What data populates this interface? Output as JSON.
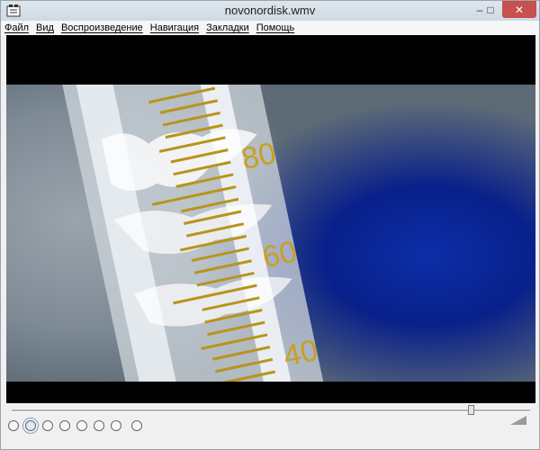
{
  "window": {
    "title": "novonordisk.wmv",
    "close_glyph": "✕",
    "min_glyph": "–",
    "max_glyph": "□"
  },
  "menu": {
    "items": [
      {
        "label": "Файл"
      },
      {
        "label": "Вид"
      },
      {
        "label": "Воспроизведение"
      },
      {
        "label": "Навигация"
      },
      {
        "label": "Закладки"
      },
      {
        "label": "Помощь"
      }
    ]
  },
  "video_frame": {
    "cylinder_labels": [
      "80",
      "60",
      "40"
    ],
    "label_color": "#c9a020"
  },
  "player": {
    "seek_position": 0.885,
    "icons": [
      "play-icon",
      "pause-icon",
      "stop-icon",
      "prev-icon",
      "next-icon",
      "step-back-icon",
      "step-forward-icon",
      "open-icon",
      "volume-icon"
    ]
  }
}
